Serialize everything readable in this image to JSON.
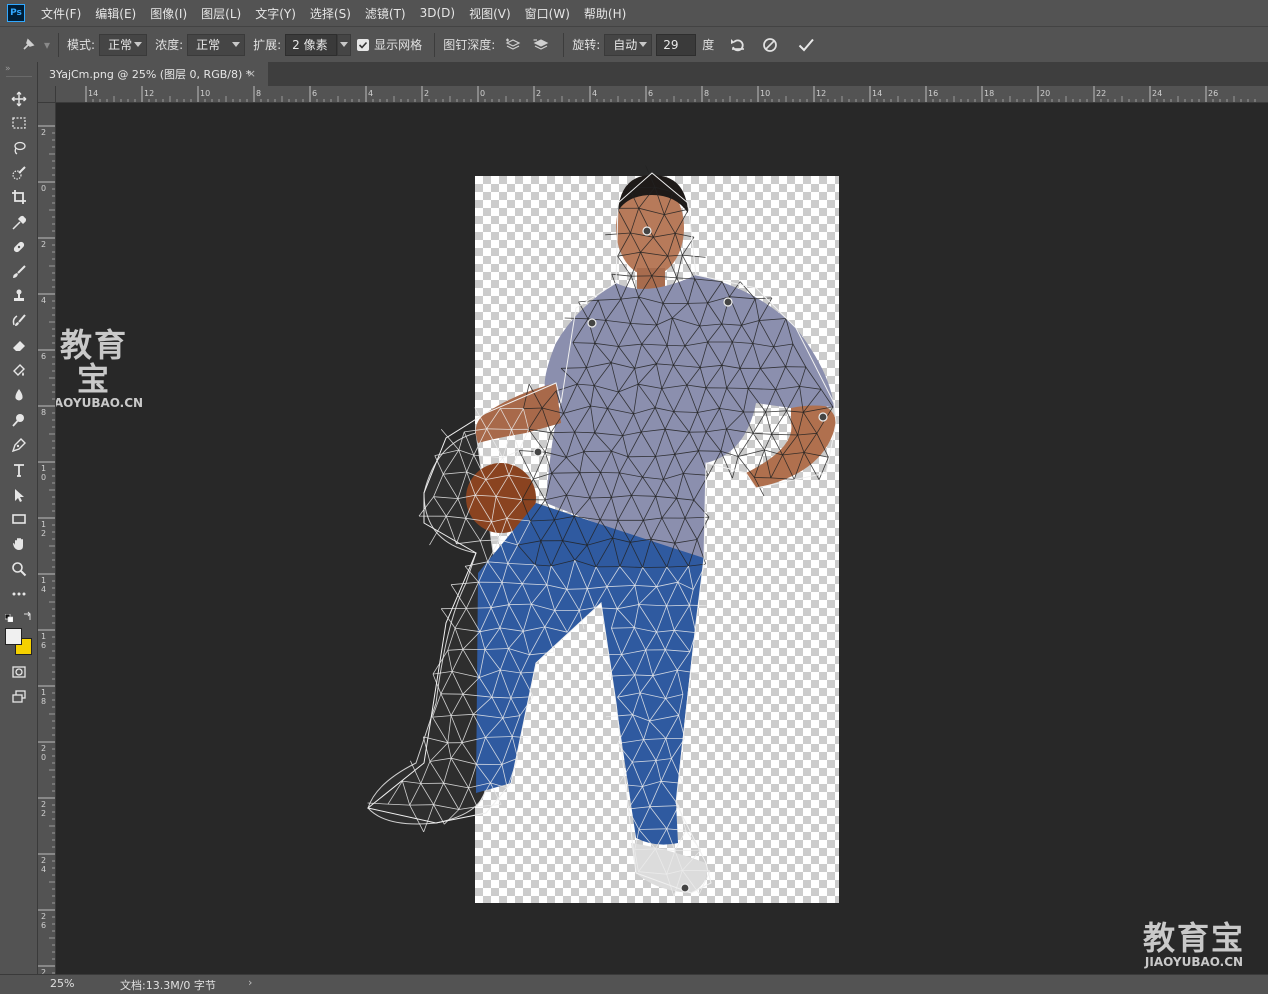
{
  "app": {
    "logo": "Ps"
  },
  "menu": [
    "文件(F)",
    "编辑(E)",
    "图像(I)",
    "图层(L)",
    "文字(Y)",
    "选择(S)",
    "滤镜(T)",
    "3D(D)",
    "视图(V)",
    "窗口(W)",
    "帮助(H)"
  ],
  "options": {
    "mode_label": "模式:",
    "mode_value": "正常",
    "density_label": "浓度:",
    "density_value": "正常",
    "expand_label": "扩展:",
    "expand_value": "2 像素",
    "show_mesh_label": "显示网格",
    "show_mesh_checked": true,
    "pin_depth_label": "图钉深度:",
    "rotate_label": "旋转:",
    "rotate_value": "自动",
    "rotate_angle": "29",
    "rotate_unit": "度"
  },
  "document": {
    "tab_title": "3YajCm.png @ 25% (图层 0, RGB/8) *",
    "close": "×"
  },
  "ruler_top": [
    "14",
    "12",
    "10",
    "8",
    "6",
    "4",
    "2",
    "0",
    "2",
    "4",
    "6",
    "8",
    "10",
    "12",
    "14",
    "16",
    "18",
    "20",
    "22",
    "24",
    "26"
  ],
  "ruler_left": [
    "2",
    "0",
    "2",
    "4",
    "6",
    "8",
    "1 0",
    "1 2",
    "1 4",
    "1 6",
    "1 8",
    "2 0",
    "2 2",
    "2 4",
    "2 6",
    "2"
  ],
  "status": {
    "zoom": "25%",
    "doc_info": "文档:13.3M/0 字节",
    "arrow": "›"
  },
  "watermark": {
    "text_cn": "教育宝",
    "text_en": "JIAOYUBAO.CN"
  },
  "colors": {
    "foreground": "#f0f0f0",
    "background": "#f5d000",
    "accent": "#31a8ff"
  },
  "icons": [
    "move-icon",
    "marquee-icon",
    "lasso-icon",
    "quick-select-icon",
    "crop-icon",
    "eyedropper-icon",
    "healing-icon",
    "brush-icon",
    "stamp-icon",
    "history-brush-icon",
    "eraser-icon",
    "gradient-icon",
    "blur-icon",
    "dodge-icon",
    "pen-icon",
    "type-icon",
    "path-select-icon",
    "rectangle-icon",
    "hand-icon",
    "zoom-icon",
    "more-tools-icon",
    "quick-mask-icon",
    "screen-mode-icon"
  ]
}
